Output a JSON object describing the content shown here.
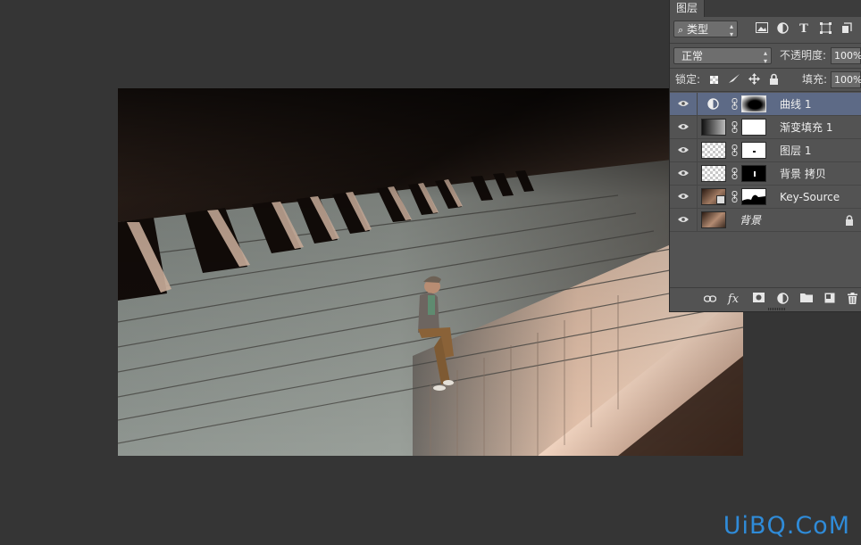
{
  "watermark": "UiBQ.CoM",
  "panel": {
    "tab": "图层",
    "filter": {
      "label": "类型",
      "prefix_icon": "search-icon"
    },
    "filter_icons": [
      "image-filter-icon",
      "adjustment-filter-icon",
      "type-filter-icon",
      "shape-filter-icon",
      "smart-object-filter-icon"
    ],
    "blend_mode": "正常",
    "opacity_label": "不透明度:",
    "opacity_value": "100%",
    "lock_label": "锁定:",
    "lock_icons": [
      "lock-transparent-icon",
      "lock-paint-icon",
      "lock-move-icon",
      "lock-all-icon"
    ],
    "fill_label": "填充:",
    "fill_value": "100%",
    "layers": [
      {
        "name": "曲线 1",
        "type": "adjustment",
        "selected": true,
        "visible": true
      },
      {
        "name": "渐变填充 1",
        "type": "gradient",
        "selected": false,
        "visible": true
      },
      {
        "name": "图层 1",
        "type": "pixel",
        "selected": false,
        "visible": true
      },
      {
        "name": "背景 拷贝",
        "type": "pixel",
        "selected": false,
        "visible": true
      },
      {
        "name": "Key-Source",
        "type": "photo",
        "selected": false,
        "visible": true
      },
      {
        "name": "背景",
        "type": "background",
        "selected": false,
        "visible": true,
        "locked": true
      }
    ],
    "footer_icons": [
      "link-layers-icon",
      "fx-icon",
      "add-mask-icon",
      "new-adjustment-icon",
      "new-group-icon",
      "new-layer-icon",
      "delete-icon"
    ],
    "footer_fx_text": "fx"
  },
  "colors": {
    "workspace": "#353535",
    "panel": "#535353",
    "selected_layer": "#5d6a86",
    "watermark": "#2f8bd8"
  }
}
